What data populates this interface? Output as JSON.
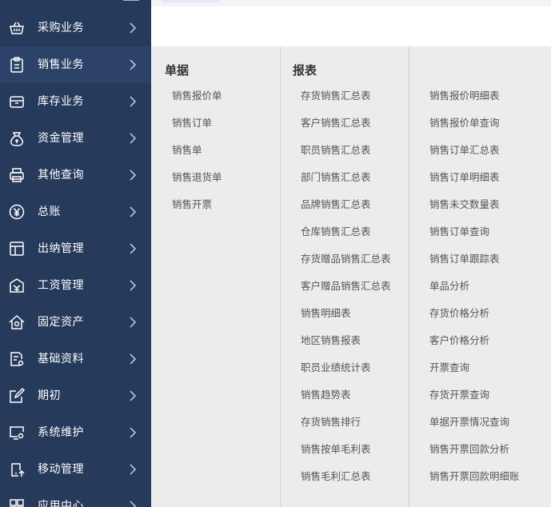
{
  "sidebar": {
    "items": [
      {
        "label": "采购业务",
        "icon": "basket-icon"
      },
      {
        "label": "销售业务",
        "icon": "clipboard-icon"
      },
      {
        "label": "库存业务",
        "icon": "inventory-box-icon"
      },
      {
        "label": "资金管理",
        "icon": "money-bag-icon"
      },
      {
        "label": "其他查询",
        "icon": "printer-icon"
      },
      {
        "label": "总账",
        "icon": "yen-circle-icon"
      },
      {
        "label": "出纳管理",
        "icon": "layout-icon"
      },
      {
        "label": "工资管理",
        "icon": "payroll-icon"
      },
      {
        "label": "固定资产",
        "icon": "house-icon"
      },
      {
        "label": "基础资料",
        "icon": "document-settings-icon"
      },
      {
        "label": "期初",
        "icon": "edit-icon"
      },
      {
        "label": "系统维护",
        "icon": "monitor-settings-icon"
      },
      {
        "label": "移动管理",
        "icon": "mobile-icon"
      },
      {
        "label": "应用中心",
        "icon": "app-center-icon"
      }
    ]
  },
  "menu": {
    "columns": [
      {
        "title": "单据",
        "links": [
          "销售报价单",
          "销售订单",
          "销售单",
          "销售退货单",
          "销售开票"
        ]
      },
      {
        "title": "报表",
        "links": [
          "存货销售汇总表",
          "客户销售汇总表",
          "职员销售汇总表",
          "部门销售汇总表",
          "品牌销售汇总表",
          "仓库销售汇总表",
          "存货赠品销售汇总表",
          "客户赠品销售汇总表",
          "销售明细表",
          "地区销售报表",
          "职员业绩统计表",
          "销售趋势表",
          "存货销售排行",
          "销售按单毛利表",
          "销售毛利汇总表"
        ]
      },
      {
        "title": "",
        "links": [
          "销售报价明细表",
          "销售报价单查询",
          "销售订单汇总表",
          "销售订单明细表",
          "销售未交数量表",
          "销售订单查询",
          "销售订单跟踪表",
          "单品分析",
          "存货价格分析",
          "客户价格分析",
          "开票查询",
          "存货开票查询",
          "单据开票情况查询",
          "销售开票回款分析",
          "销售开票回款明细账"
        ]
      }
    ]
  },
  "colors": {
    "sidebar_bg": "#263a5c",
    "panel_bg": "#ececec",
    "text": "#555555"
  }
}
